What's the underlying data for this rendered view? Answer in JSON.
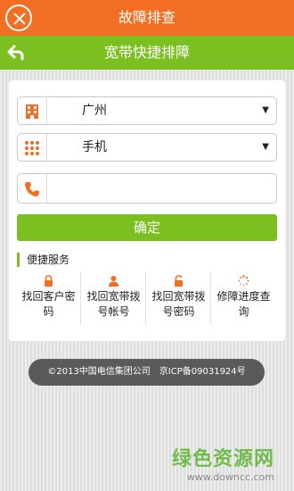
{
  "header": {
    "title": "故障排查",
    "close_icon": "close-icon"
  },
  "subheader": {
    "title": "宽带快捷排障",
    "back_icon": "back-arrow-icon"
  },
  "form": {
    "city": {
      "value": "广州",
      "icon": "building-icon"
    },
    "device": {
      "value": "手机",
      "icon": "grid-dots-icon"
    },
    "phone": {
      "placeholder": "",
      "icon": "phone-icon"
    },
    "confirm_label": "确定"
  },
  "shortcuts": {
    "title": "便捷服务",
    "items": [
      {
        "label": "找回客户密码",
        "icon": "lock-icon"
      },
      {
        "label": "找回宽带拨号帐号",
        "icon": "user-icon"
      },
      {
        "label": "找回宽带拨号密码",
        "icon": "unlock-icon"
      },
      {
        "label": "修障进度查询",
        "icon": "spinner-icon"
      }
    ]
  },
  "footer": {
    "copyright": "©2013中国电信集团公司　京ICP备09031924号"
  },
  "watermark": {
    "main": "绿色资源网",
    "sub": "www.downcc.com"
  },
  "colors": {
    "orange": "#f26e22",
    "green": "#7bbf21"
  }
}
